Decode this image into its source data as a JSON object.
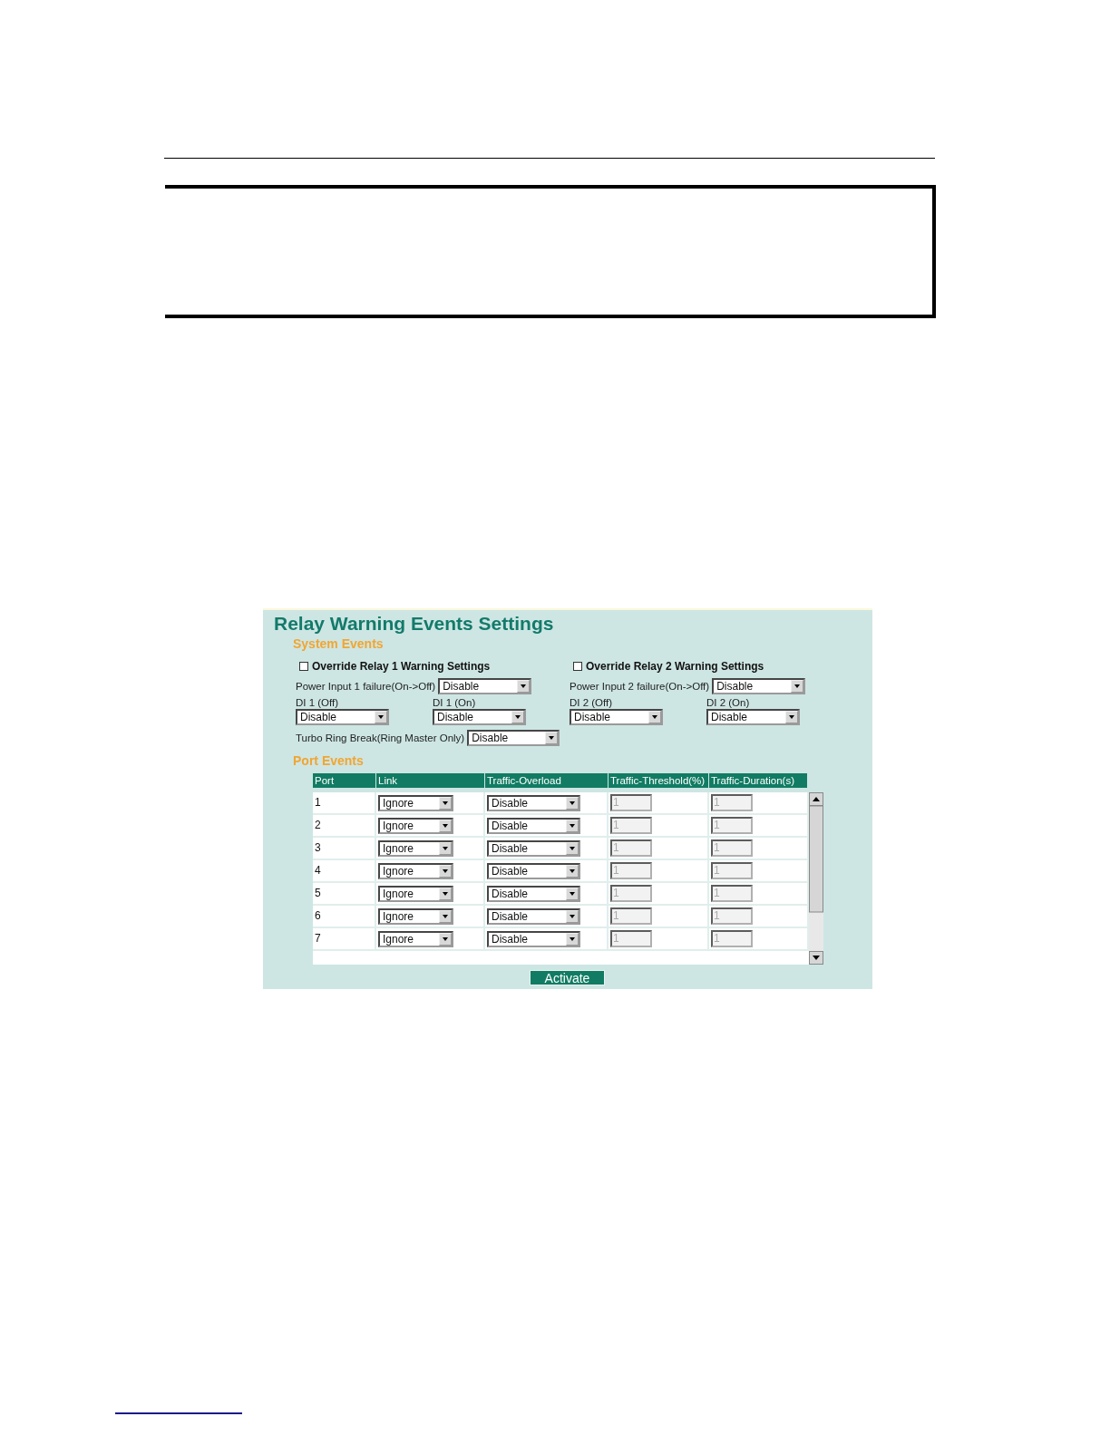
{
  "title": "Relay Warning Events Settings",
  "system_events": {
    "heading": "System Events",
    "relays": [
      {
        "override_label": "Override Relay 1 Warning Settings",
        "checked": false,
        "power_label": "Power Input 1 failure(On->Off)",
        "power_value": "Disable",
        "di_off_label": "DI 1 (Off)",
        "di_off_value": "Disable",
        "di_on_label": "DI 1 (On)",
        "di_on_value": "Disable"
      },
      {
        "override_label": "Override Relay 2 Warning Settings",
        "checked": false,
        "power_label": "Power Input 2 failure(On->Off)",
        "power_value": "Disable",
        "di_off_label": "DI 2 (Off)",
        "di_off_value": "Disable",
        "di_on_label": "DI 2 (On)",
        "di_on_value": "Disable"
      }
    ],
    "turbo_ring": {
      "label": "Turbo Ring Break(Ring Master Only)",
      "value": "Disable"
    }
  },
  "port_events": {
    "heading": "Port Events",
    "columns": [
      "Port",
      "Link",
      "Traffic-Overload",
      "Traffic-Threshold(%)",
      "Traffic-Duration(s)"
    ],
    "rows": [
      {
        "port": "1",
        "link": "Ignore",
        "overload": "Disable",
        "threshold": "1",
        "duration": "1",
        "disabled": true
      },
      {
        "port": "2",
        "link": "Ignore",
        "overload": "Disable",
        "threshold": "1",
        "duration": "1",
        "disabled": true
      },
      {
        "port": "3",
        "link": "Ignore",
        "overload": "Disable",
        "threshold": "1",
        "duration": "1",
        "disabled": true
      },
      {
        "port": "4",
        "link": "Ignore",
        "overload": "Disable",
        "threshold": "1",
        "duration": "1",
        "disabled": true
      },
      {
        "port": "5",
        "link": "Ignore",
        "overload": "Disable",
        "threshold": "1",
        "duration": "1",
        "disabled": true
      },
      {
        "port": "6",
        "link": "Ignore",
        "overload": "Disable",
        "threshold": "1",
        "duration": "1",
        "disabled": true
      },
      {
        "port": "7",
        "link": "Ignore",
        "overload": "Disable",
        "threshold": "1",
        "duration": "1",
        "disabled": true
      }
    ]
  },
  "activate_button": "Activate"
}
